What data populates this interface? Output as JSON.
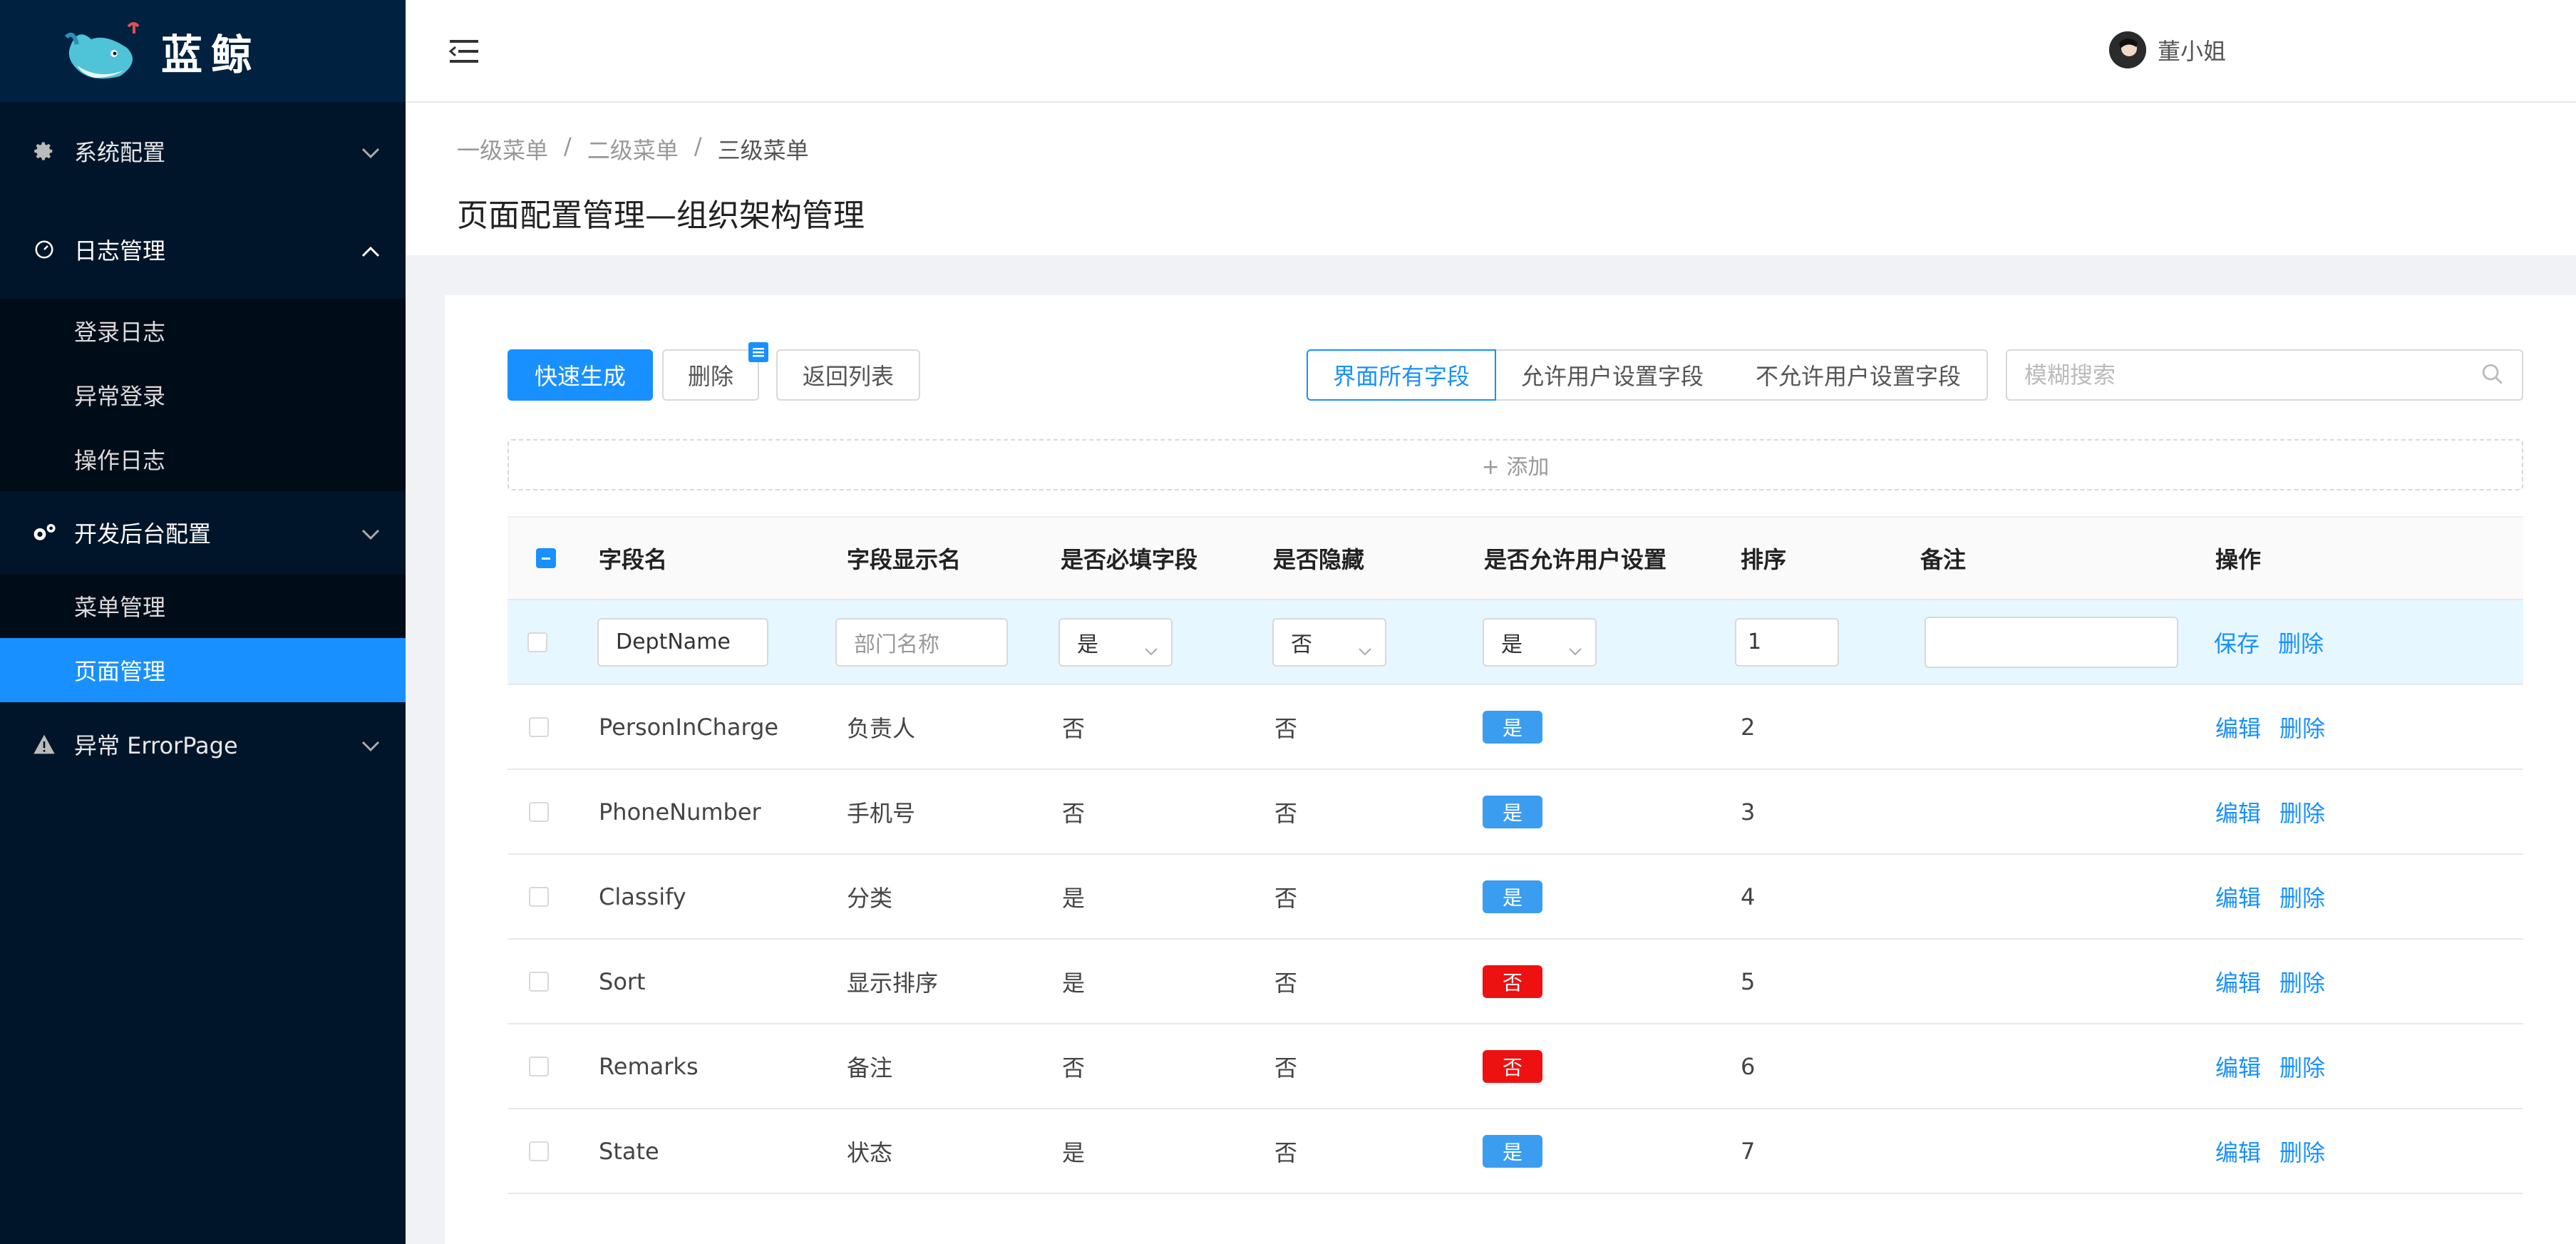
{
  "app": {
    "name": "蓝鲸"
  },
  "sidebar": {
    "items": [
      {
        "label": "系统配置",
        "icon": "gear-icon",
        "expanded": false
      },
      {
        "label": "日志管理",
        "icon": "dashboard-icon",
        "expanded": true,
        "children": [
          "登录日志",
          "异常登录",
          "操作日志"
        ]
      },
      {
        "label": "开发后台配置",
        "icon": "gears-icon",
        "expanded": true,
        "children": [
          "菜单管理",
          "页面管理"
        ],
        "active_child": "页面管理"
      },
      {
        "label": "异常 ErrorPage",
        "icon": "warning-icon",
        "expanded": false
      }
    ]
  },
  "header": {
    "user_name": "董小姐"
  },
  "breadcrumb": [
    "一级菜单",
    "二级菜单",
    "三级菜单"
  ],
  "page_title": "页面配置管理—组织架构管理",
  "toolbar": {
    "quick_generate": "快速生成",
    "delete": "删除",
    "back": "返回列表",
    "segments": [
      "界面所有字段",
      "允许用户设置字段",
      "不允许用户设置字段"
    ],
    "active_segment": "界面所有字段",
    "search_placeholder": "模糊搜索",
    "add": "+ 添加"
  },
  "table": {
    "columns": [
      "字段名",
      "字段显示名",
      "是否必填字段",
      "是否隐藏",
      "是否允许用户设置",
      "排序",
      "备注",
      "操作"
    ],
    "edit_row": {
      "field_name": "DeptName",
      "display_placeholder": "部门名称",
      "required": "是",
      "hidden": "否",
      "user_settable": "是",
      "sort": "1",
      "remark": "",
      "save": "保存",
      "delete": "删除"
    },
    "rows": [
      {
        "field_name": "PersonInCharge",
        "display": "负责人",
        "required": "否",
        "hidden": "否",
        "user_settable": "是",
        "sort": "2"
      },
      {
        "field_name": "PhoneNumber",
        "display": "手机号",
        "required": "否",
        "hidden": "否",
        "user_settable": "是",
        "sort": "3"
      },
      {
        "field_name": "Classify",
        "display": "分类",
        "required": "是",
        "hidden": "否",
        "user_settable": "是",
        "sort": "4"
      },
      {
        "field_name": "Sort",
        "display": "显示排序",
        "required": "是",
        "hidden": "否",
        "user_settable": "否",
        "sort": "5"
      },
      {
        "field_name": "Remarks",
        "display": "备注",
        "required": "否",
        "hidden": "否",
        "user_settable": "否",
        "sort": "6"
      },
      {
        "field_name": "State",
        "display": "状态",
        "required": "是",
        "hidden": "否",
        "user_settable": "是",
        "sort": "7"
      }
    ],
    "edit_label": "编辑",
    "delete_label": "删除"
  },
  "colors": {
    "primary": "#1890ff",
    "sidebar_bg": "#001529",
    "tag_yes": "#3b9df0",
    "tag_no": "#ee1111"
  }
}
